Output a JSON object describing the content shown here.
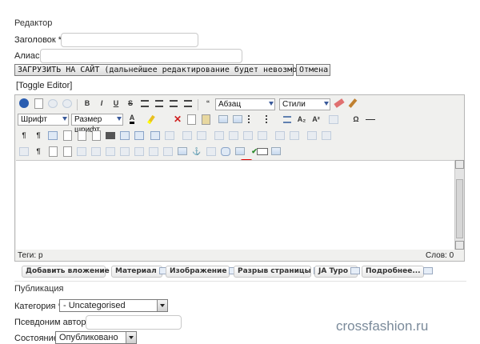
{
  "editor_section": {
    "title": "Редактор",
    "title_label": "Заголовок *",
    "title_value": "",
    "alias_label": "Алиас",
    "alias_value": "",
    "upload_button": "ЗАГРУЗИТЬ НА САЙТ (дальнейшее редактирование будет невозможно)",
    "cancel_button": "Отмена",
    "toggle_editor": "[Toggle Editor]"
  },
  "toolbar": {
    "format_select": "Абзац",
    "styles_select": "Стили",
    "font_select": "Шрифт",
    "size_select": "Размер шрифт",
    "bold": "B",
    "italic": "I",
    "underline": "U",
    "strike": "S",
    "quote": "“",
    "subscript": "A₂",
    "superscript": "A²",
    "omega": "Ω"
  },
  "status_bar": {
    "path_label": "Теги:",
    "path_value": "p",
    "word_count": "Слов: 0"
  },
  "extra_buttons": [
    {
      "label": "Добавить вложение"
    },
    {
      "label": "Материал"
    },
    {
      "label": "Изображение"
    },
    {
      "label": "Разрыв страницы"
    },
    {
      "label": "JA Typo"
    },
    {
      "label": "Подробнее..."
    }
  ],
  "publication": {
    "title": "Публикация",
    "category_label": "Категория *",
    "category_value": "- Uncategorised",
    "author_alias_label": "Псевдоним автора",
    "author_alias_value": "",
    "state_label": "Состояние",
    "state_value": "Опубликовано"
  },
  "watermark": "crossfashion.ru",
  "colors": {
    "accent": "#3a5a9a",
    "highlight_red": "#e00000"
  }
}
